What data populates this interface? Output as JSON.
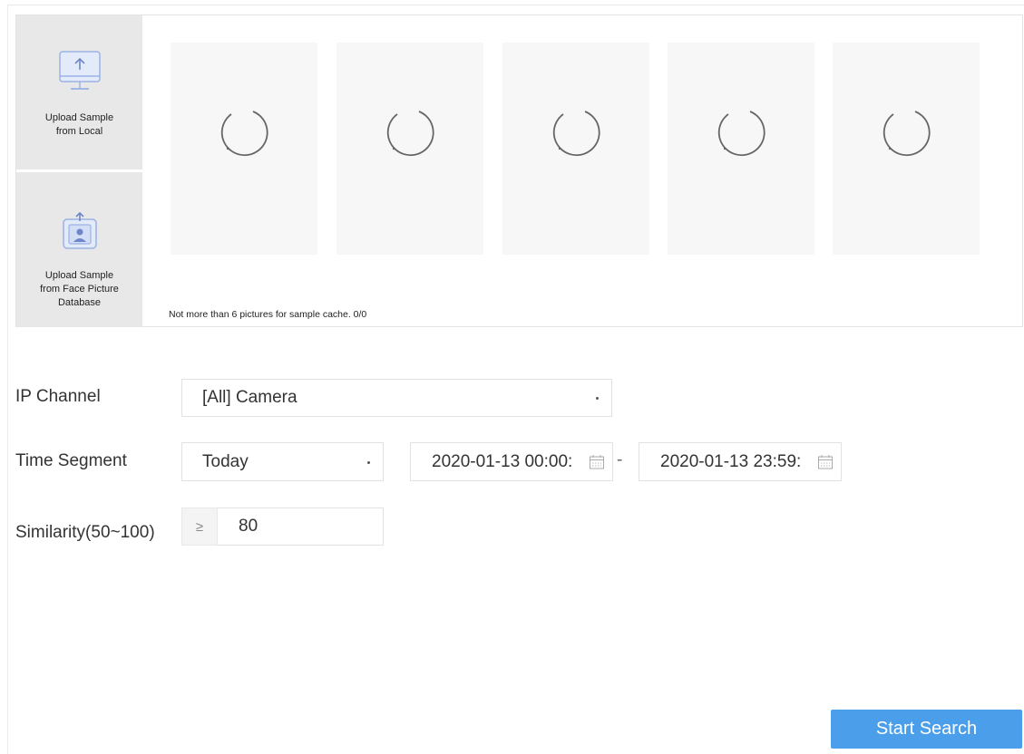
{
  "upload": {
    "local_label": "Upload Sample\nfrom Local",
    "database_label": "Upload Sample\nfrom Face Picture\nDatabase",
    "local_icon": "monitor-upload-icon",
    "database_icon": "face-database-upload-icon"
  },
  "slots": [
    {
      "icon": "loading-spinner-icon"
    },
    {
      "icon": "loading-spinner-icon"
    },
    {
      "icon": "loading-spinner-icon"
    },
    {
      "icon": "loading-spinner-icon"
    },
    {
      "icon": "loading-spinner-icon"
    }
  ],
  "cache_note": "Not more than 6 pictures for sample cache. 0/0",
  "form": {
    "ip_channel": {
      "label": "IP Channel",
      "value": "[All] Camera"
    },
    "time_segment": {
      "label": "Time Segment",
      "value": "Today",
      "start": "2020-01-13 00:00:",
      "separator": "-",
      "end": "2020-01-13 23:59:"
    },
    "similarity": {
      "label": "Similarity(50~100)",
      "operator": "≥",
      "value": "80"
    }
  },
  "actions": {
    "start_search": "Start Search"
  },
  "colors": {
    "accent": "#4a9eea",
    "upload_bg": "#e8e8e8",
    "slot_bg": "#f7f7f7"
  }
}
